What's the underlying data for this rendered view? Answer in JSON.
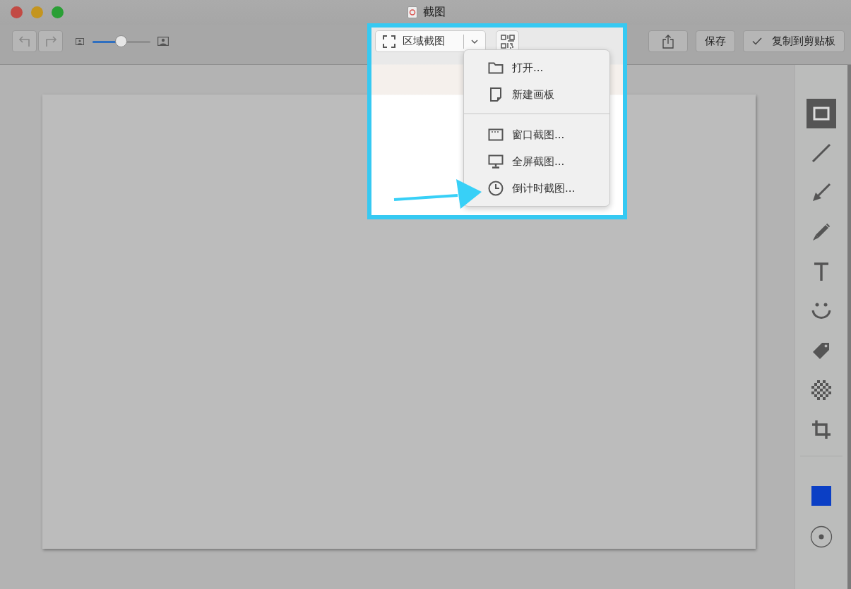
{
  "window": {
    "title": "截图"
  },
  "toolbar": {
    "zoom": {
      "level": 0.5
    },
    "capture_mode": {
      "label": "区域截图"
    },
    "buttons": [
      {
        "kind": "share"
      },
      {
        "kind": "text",
        "label": "保存"
      },
      {
        "kind": "check",
        "label": "复制到剪贴板"
      }
    ]
  },
  "menu": {
    "sections": [
      [
        {
          "kind": "folder",
          "label": "打开..."
        },
        {
          "kind": "page",
          "label": "新建画板"
        }
      ],
      [
        {
          "kind": "window",
          "label": "窗口截图..."
        },
        {
          "kind": "monitor",
          "label": "全屏截图..."
        },
        {
          "kind": "clock",
          "label": "倒计时截图..."
        }
      ]
    ]
  },
  "tools": [
    {
      "kind": "rectangle",
      "selected": true
    },
    {
      "kind": "line",
      "selected": false
    },
    {
      "kind": "arrow",
      "selected": false
    },
    {
      "kind": "pencil",
      "selected": false
    },
    {
      "kind": "text",
      "selected": false
    },
    {
      "kind": "emoji",
      "selected": false
    },
    {
      "kind": "tag",
      "selected": false
    },
    {
      "kind": "mosaic",
      "selected": false
    },
    {
      "kind": "crop",
      "selected": false
    }
  ],
  "stroke": {
    "color": "#0b3fc5"
  }
}
